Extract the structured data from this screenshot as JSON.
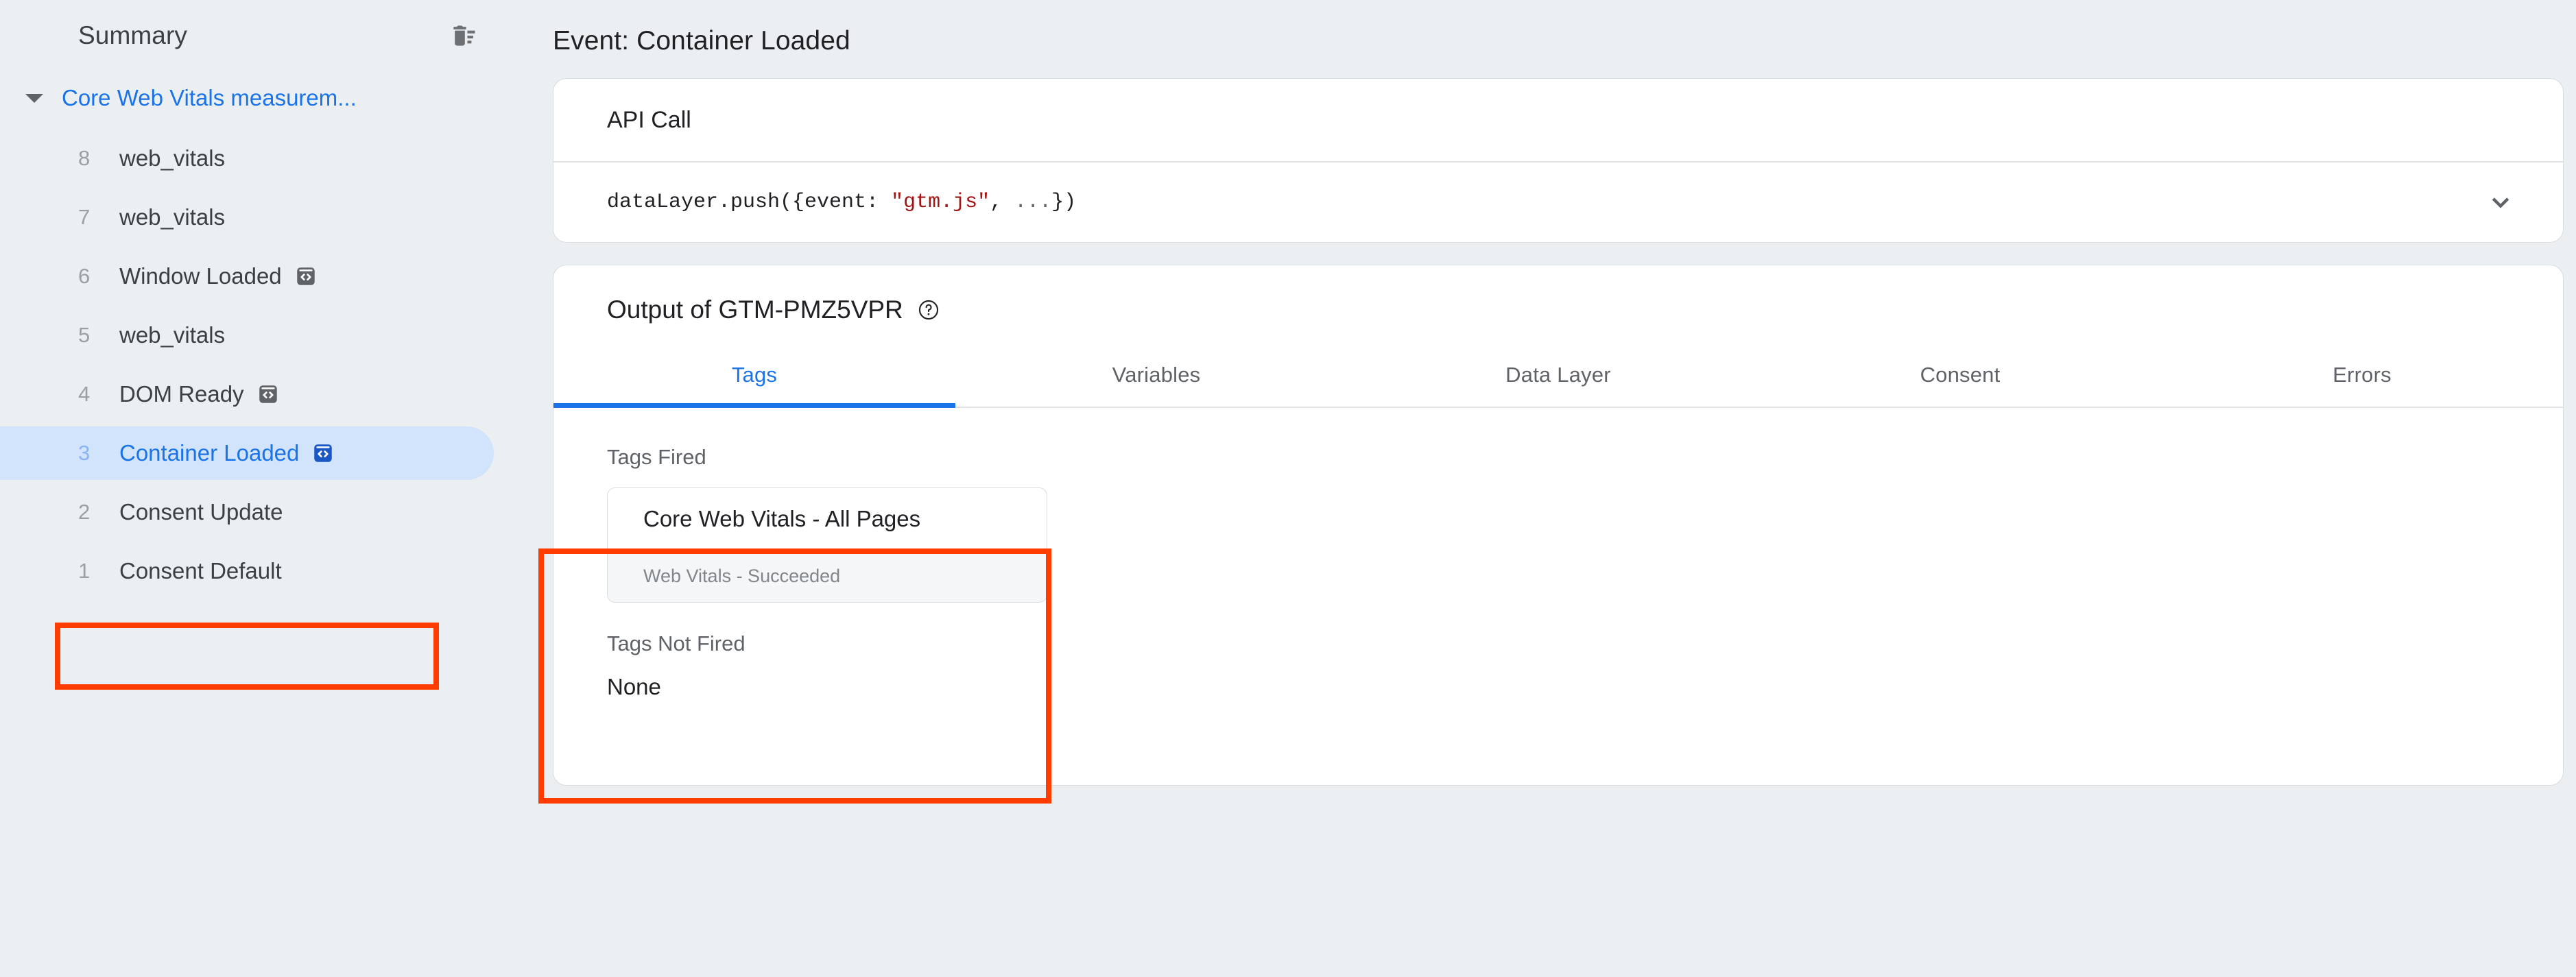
{
  "sidebar": {
    "title": "Summary",
    "clear_icon": "delete-sweep-icon",
    "group": {
      "label": "Core Web Vitals measurem...",
      "caret_icon": "caret-down-icon",
      "expanded": true
    },
    "events": [
      {
        "num": "8",
        "name": "web_vitals",
        "badge": null
      },
      {
        "num": "7",
        "name": "web_vitals",
        "badge": null
      },
      {
        "num": "6",
        "name": "Window Loaded",
        "badge": "code-badge-icon"
      },
      {
        "num": "5",
        "name": "web_vitals",
        "badge": null
      },
      {
        "num": "4",
        "name": "DOM Ready",
        "badge": "code-badge-icon"
      },
      {
        "num": "3",
        "name": "Container Loaded",
        "badge": "code-badge-icon",
        "selected": true
      },
      {
        "num": "2",
        "name": "Consent Update",
        "badge": null
      },
      {
        "num": "1",
        "name": "Consent Default",
        "badge": null
      }
    ]
  },
  "main": {
    "title": "Event: Container Loaded",
    "api_call": {
      "header": "API Call",
      "code_prefix": "dataLayer.push({event: ",
      "code_string": "\"gtm.js\"",
      "code_middle": ", ",
      "code_dots": "...",
      "code_suffix": "})",
      "expand_icon": "chevron-down-icon"
    },
    "output": {
      "title": "Output of GTM-PMZ5VPR",
      "help_icon": "help-circle-icon",
      "tabs": [
        {
          "label": "Tags",
          "active": true
        },
        {
          "label": "Variables",
          "active": false
        },
        {
          "label": "Data Layer",
          "active": false
        },
        {
          "label": "Consent",
          "active": false
        },
        {
          "label": "Errors",
          "active": false
        }
      ],
      "tags_fired": {
        "label": "Tags Fired",
        "items": [
          {
            "name": "Core Web Vitals - All Pages",
            "status": "Web Vitals - Succeeded"
          }
        ]
      },
      "tags_not_fired": {
        "label": "Tags Not Fired",
        "value": "None"
      }
    }
  },
  "colors": {
    "accent_blue": "#1a73e8",
    "selected_pill": "#d2e3fc",
    "annotation_red": "#ff3d00",
    "page_bg": "#eceff1",
    "code_string": "#a31515"
  }
}
